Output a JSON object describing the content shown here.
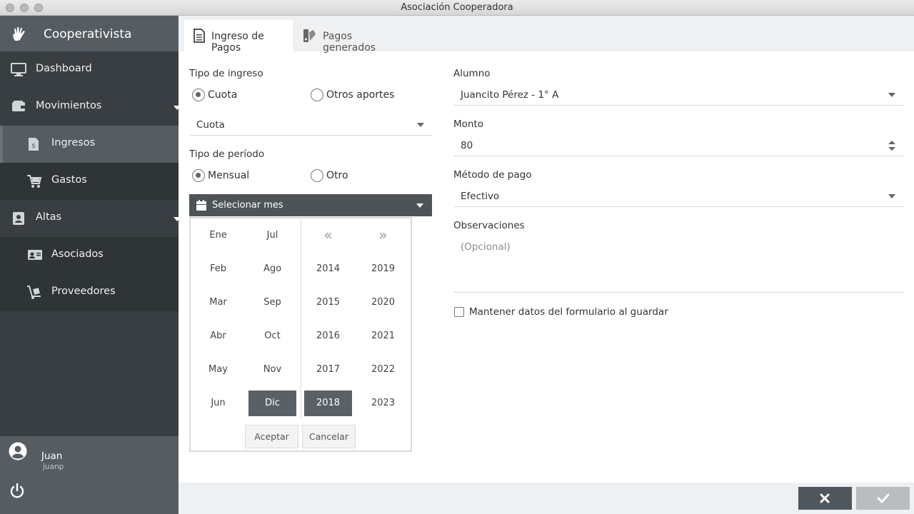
{
  "window": {
    "title": "Asociación Cooperadora"
  },
  "sidebar": {
    "brand": "Cooperativista",
    "items": [
      {
        "label": "Dashboard"
      },
      {
        "label": "Movimientos"
      },
      {
        "label": "Ingresos"
      },
      {
        "label": "Gastos"
      },
      {
        "label": "Altas"
      },
      {
        "label": "Asociados"
      },
      {
        "label": "Proveedores"
      }
    ],
    "user": {
      "name": "Juan",
      "login": "juanp"
    }
  },
  "tabs": [
    {
      "label": "Ingreso de Pagos",
      "active": true
    },
    {
      "label": "Pagos generados",
      "active": false
    }
  ],
  "form": {
    "tipo_ingreso": {
      "label": "Tipo de ingreso",
      "options": [
        "Cuota",
        "Otros aportes"
      ],
      "selected": "Cuota"
    },
    "cuota_select": {
      "value": "Cuota"
    },
    "tipo_periodo": {
      "label": "Tipo de período",
      "options": [
        "Mensual",
        "Otro"
      ],
      "selected": "Mensual"
    },
    "month_button": {
      "label": "Selecionar mes"
    },
    "picker": {
      "months_col1": [
        "Ene",
        "Feb",
        "Mar",
        "Abr",
        "May",
        "Jun"
      ],
      "months_col2": [
        "Jul",
        "Ago",
        "Sep",
        "Oct",
        "Nov",
        "Dic"
      ],
      "nav_prev": "«",
      "nav_next": "»",
      "years_col1": [
        "2014",
        "2015",
        "2016",
        "2017",
        "2018"
      ],
      "years_col2": [
        "2019",
        "2020",
        "2021",
        "2022",
        "2023"
      ],
      "selected_month": "Dic",
      "selected_year": "2018",
      "accept": "Aceptar",
      "cancel": "Cancelar"
    },
    "alumno": {
      "label": "Alumno",
      "value": "Juancito Pérez - 1° A"
    },
    "monto": {
      "label": "Monto",
      "value": "80"
    },
    "metodo": {
      "label": "Método de pago",
      "value": "Efectivo"
    },
    "observaciones": {
      "label": "Observaciones",
      "placeholder": "(Opcional)"
    },
    "keep_data": {
      "label": "Mantener datos del formulario al guardar",
      "checked": false
    }
  },
  "colors": {
    "sidebar": "#393e42",
    "sidebar_active": "#565d62",
    "selected": "#5a6166"
  }
}
